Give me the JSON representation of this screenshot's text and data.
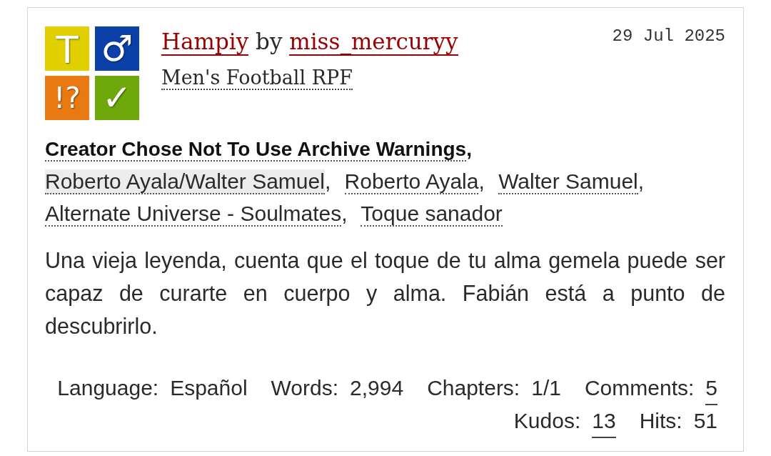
{
  "blurb": {
    "required_tags": [
      {
        "kind": "rating",
        "symbol": "T",
        "color": "#e2cf00"
      },
      {
        "kind": "category",
        "symbol": "♂",
        "color": "#0b40a8"
      },
      {
        "kind": "warning",
        "symbol": "!?",
        "color": "#e97a12"
      },
      {
        "kind": "complete",
        "symbol": "✓",
        "color": "#6fa80a"
      }
    ],
    "title": "Hampiy",
    "byline": "by",
    "author": "miss_mercuryy",
    "date": "29 Jul 2025",
    "fandoms": [
      "Men's Football RPF"
    ],
    "tags": [
      {
        "kind": "warning",
        "label": "Creator Chose Not To Use Archive Warnings",
        "separator": ","
      },
      {
        "kind": "relationship",
        "label": "Roberto Ayala/Walter Samuel",
        "separator": ","
      },
      {
        "kind": "character",
        "label": "Roberto Ayala",
        "separator": ","
      },
      {
        "kind": "character",
        "label": "Walter Samuel",
        "separator": ","
      },
      {
        "kind": "freeform",
        "label": "Alternate Universe - Soulmates",
        "separator": ","
      },
      {
        "kind": "freeform",
        "label": "Toque sanador"
      }
    ],
    "summary": "Una vieja leyenda, cuenta que el toque de tu alma gemela puede ser capaz de curarte en cuerpo y alma. Fabián está a punto de descubrirlo.",
    "stats": [
      {
        "kind": "text",
        "label": "Language:",
        "value": "Español"
      },
      {
        "kind": "text",
        "label": "Words:",
        "value": "2,994"
      },
      {
        "kind": "text",
        "label": "Chapters:",
        "value": "1/1"
      },
      {
        "kind": "link",
        "label": "Comments:",
        "value": "5"
      },
      {
        "kind": "link",
        "label": "Kudos:",
        "value": "13"
      },
      {
        "kind": "text",
        "label": "Hits:",
        "value": "51"
      }
    ]
  }
}
